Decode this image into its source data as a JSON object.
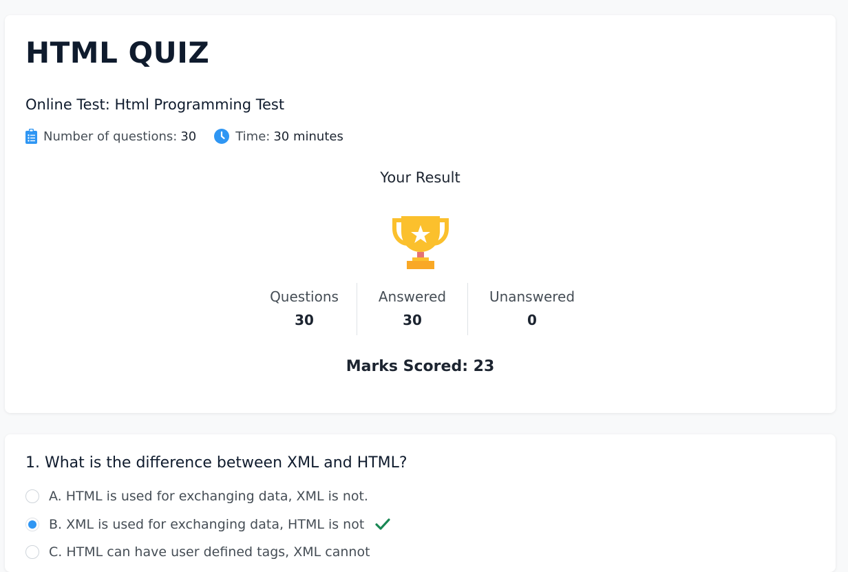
{
  "quiz": {
    "title": "HTML QUIZ",
    "subtitle": "Online Test: Html Programming Test",
    "questions_label": "Number of questions:",
    "questions_count": "30",
    "time_label": "Time:",
    "time_value": "30 minutes"
  },
  "result": {
    "title": "Your Result",
    "trophy_icon": "trophy-icon",
    "stats": [
      {
        "label": "Questions",
        "value": "30"
      },
      {
        "label": "Answered",
        "value": "30"
      },
      {
        "label": "Unanswered",
        "value": "0"
      }
    ],
    "marks_label": "Marks Scored: 23"
  },
  "question1": {
    "text": "1. What is the difference between XML and HTML?",
    "options": [
      {
        "label": "A. HTML is used for exchanging data, XML is not.",
        "selected": false
      },
      {
        "label": "B. XML is used for exchanging data, HTML is not",
        "selected": true,
        "correct": true
      },
      {
        "label": "C. HTML can have user defined tags, XML cannot",
        "selected": false
      }
    ]
  },
  "colors": {
    "accent": "#2f96f3",
    "correct": "#198754",
    "trophy_gold": "#fbc02d",
    "trophy_base": "#f9a825"
  }
}
